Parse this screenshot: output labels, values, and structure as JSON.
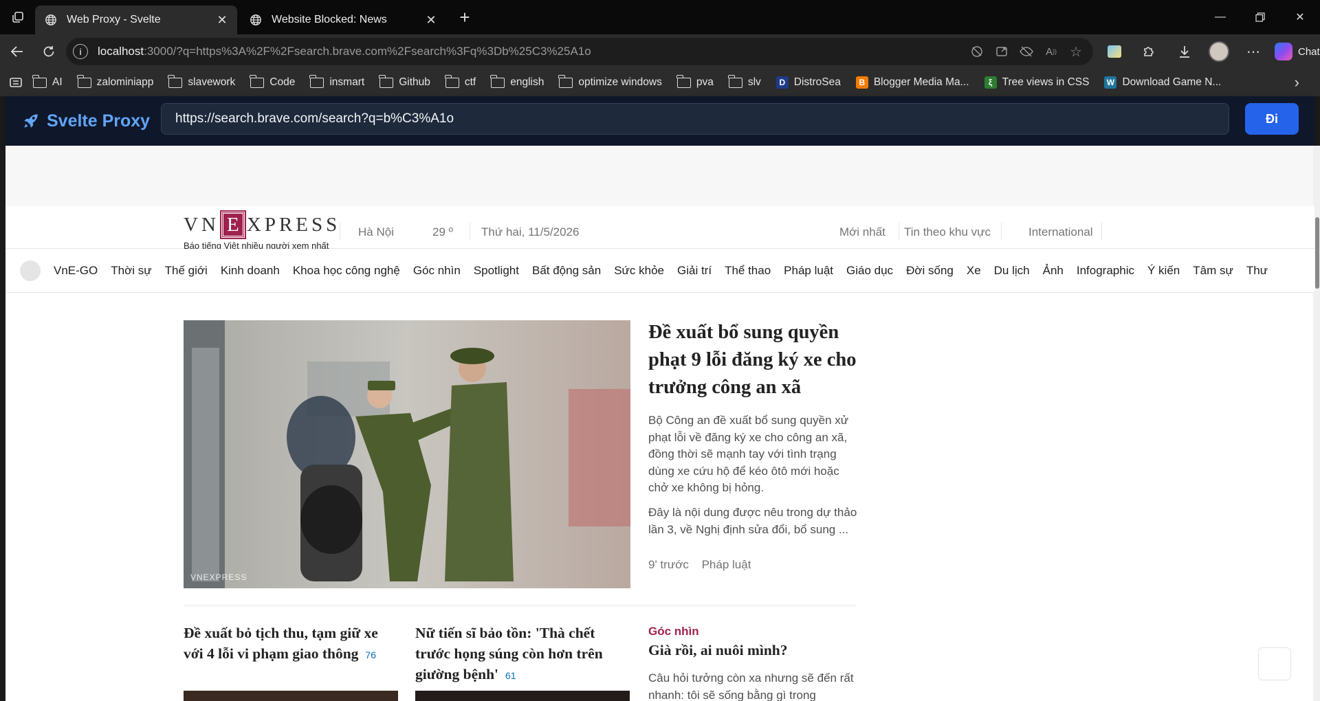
{
  "browser": {
    "tabs": [
      {
        "title": "Web Proxy - Svelte",
        "active": true
      },
      {
        "title": "Website Blocked: News",
        "active": false
      }
    ],
    "address": {
      "host": "localhost",
      "rest": ":3000/?q=https%3A%2F%2Fsearch.brave.com%2Fsearch%3Fq%3Db%25C3%25A1o"
    },
    "chat_label": "Chat",
    "bookmarks": [
      {
        "label": "AI",
        "icon": "folder-icon"
      },
      {
        "label": "zalominiapp",
        "icon": "folder-icon"
      },
      {
        "label": "slavework",
        "icon": "folder-icon"
      },
      {
        "label": "Code",
        "icon": "folder-icon"
      },
      {
        "label": "insmart",
        "icon": "folder-icon"
      },
      {
        "label": "Github",
        "icon": "folder-icon"
      },
      {
        "label": "ctf",
        "icon": "folder-icon"
      },
      {
        "label": "english",
        "icon": "folder-icon"
      },
      {
        "label": "optimize windows",
        "icon": "folder-icon"
      },
      {
        "label": "pva",
        "icon": "folder-icon"
      },
      {
        "label": "slv",
        "icon": "folder-icon"
      },
      {
        "label": "DistroSea",
        "icon": "distrosea-favicon",
        "favicon_letter": "D",
        "color": "#1e3a8a"
      },
      {
        "label": "Blogger Media Ma...",
        "icon": "blogger-favicon",
        "favicon_letter": "B",
        "color": "#f57c00"
      },
      {
        "label": "Tree views in CSS",
        "icon": "tree-favicon",
        "favicon_letter": "ξ",
        "color": "#2e7d32"
      },
      {
        "label": "Download Game N...",
        "icon": "wordpress-favicon",
        "favicon_letter": "W",
        "color": "#21759b"
      }
    ]
  },
  "proxy": {
    "brand": "Svelte Proxy",
    "input_value": "https://search.brave.com/search?q=b%C3%A1o",
    "go_label": "Đi",
    "colors": {
      "bar": "#0f172a",
      "accent": "#60a5fa",
      "button": "#2563eb"
    }
  },
  "vne": {
    "logo_left": "VN",
    "logo_mid": "E",
    "logo_right": "XPRESS",
    "slogan": "Báo tiếng Việt nhiều người xem nhất",
    "city": "Hà Nội",
    "temp": "29 º",
    "date": "Thứ hai, 11/5/2026",
    "latest": "Mới nhất",
    "regional": "Tin theo khu vực",
    "international": "International",
    "nav": [
      "VnE-GO",
      "Thời sự",
      "Thế giới",
      "Kinh doanh",
      "Khoa học công nghệ",
      "Góc nhìn",
      "Spotlight",
      "Bất động sản",
      "Sức khỏe",
      "Giải trí",
      "Thể thao",
      "Pháp luật",
      "Giáo dục",
      "Đời sống",
      "Xe",
      "Du lịch",
      "Ảnh",
      "Infographic",
      "Ý kiến",
      "Tâm sự",
      "Thư"
    ],
    "feature": {
      "title": "Đề xuất bổ sung quyền phạt 9 lỗi đăng ký xe cho trưởng công an xã",
      "desc": "Bộ Công an đề xuất bổ sung quyền xử phạt lỗi về đăng ký xe cho công an xã, đồng thời sẽ mạnh tay với tình trạng dùng xe cứu hộ để kéo ôtô mới hoặc chở xe không bị hỏng.",
      "desc2": "Đây là nội dung được nêu trong dự thảo lần 3, về Nghị định sửa đổi, bổ sung ...",
      "time": "9' trước",
      "category": "Pháp luật",
      "watermark": "VNEXPRESS"
    },
    "sub1": {
      "title": "Đề xuất bỏ tịch thu, tạm giữ xe với 4 lỗi vi phạm giao thông",
      "comments": "76"
    },
    "sub2": {
      "title": "Nữ tiến sĩ bảo tồn: 'Thà chết trước họng súng còn hơn trên giường bệnh'",
      "comments": "61"
    },
    "opinion": {
      "category": "Góc nhìn",
      "title": "Già rồi, ai nuôi mình?",
      "desc": "Câu hỏi tưởng còn xa nhưng sẽ đến rất nhanh: tôi sẽ sống bằng gì trong"
    },
    "colors": {
      "brand": "#9f224e",
      "comment": "#076db6"
    }
  }
}
